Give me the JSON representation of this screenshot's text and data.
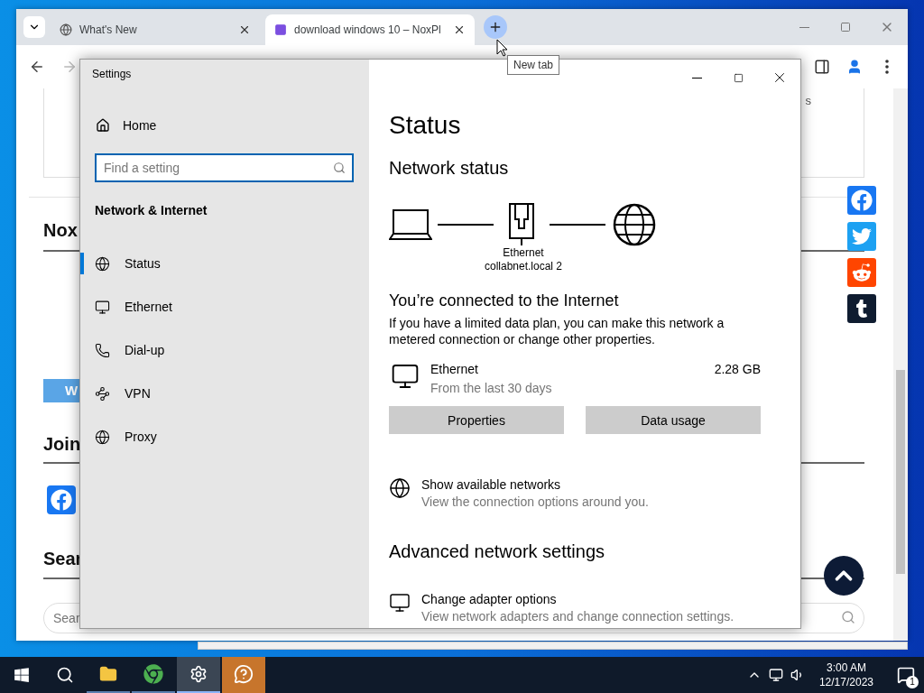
{
  "browser": {
    "tabs": [
      {
        "title": "What's New",
        "selected": false
      },
      {
        "title": "download windows 10 – NoxPl",
        "selected": true
      }
    ],
    "nav_buttons": [
      {
        "disabled": false
      },
      {
        "disabled": true
      }
    ],
    "tooltip": "New tab",
    "page": {
      "card_text": "s",
      "heading_1": "Nox",
      "button": "W",
      "heading_2": "Join",
      "heading_3": "Sear",
      "search_placeholder": "Sear"
    }
  },
  "settings": {
    "title": "Settings",
    "home": "Home",
    "search_placeholder": "Find a setting",
    "section": "Network & Internet",
    "items": [
      {
        "label": "Status",
        "selected": true
      },
      {
        "label": "Ethernet",
        "selected": false
      },
      {
        "label": "Dial-up",
        "selected": false
      },
      {
        "label": "VPN",
        "selected": false
      },
      {
        "label": "Proxy",
        "selected": false
      }
    ],
    "page_title": "Status",
    "network_heading": "Network status",
    "diagram_labels": [
      "Ethernet",
      "collabnet.local 2"
    ],
    "connected_heading": "You’re connected to the Internet",
    "description": "If you have a limited data plan, you can make this network a metered connection or change other properties.",
    "adapter": {
      "name": "Ethernet",
      "subtitle": "From the last 30 days",
      "usage": "2.28 GB"
    },
    "buttons": [
      "Properties",
      "Data usage"
    ],
    "links": [
      {
        "title": "Show available networks",
        "subtitle": "View the connection options around you."
      }
    ],
    "advanced_heading": "Advanced network settings",
    "advanced_links": [
      {
        "title": "Change adapter options",
        "subtitle": "View network adapters and change connection settings."
      }
    ]
  },
  "taskbar": {
    "apps": [
      {
        "selected": false,
        "flashing": false
      },
      {
        "selected": false,
        "flashing": false
      },
      {
        "selected": true,
        "flashing": false
      },
      {
        "selected": false,
        "flashing": true
      }
    ],
    "time": "3:00 AM",
    "date": "12/17/2023",
    "notifications": "1"
  }
}
